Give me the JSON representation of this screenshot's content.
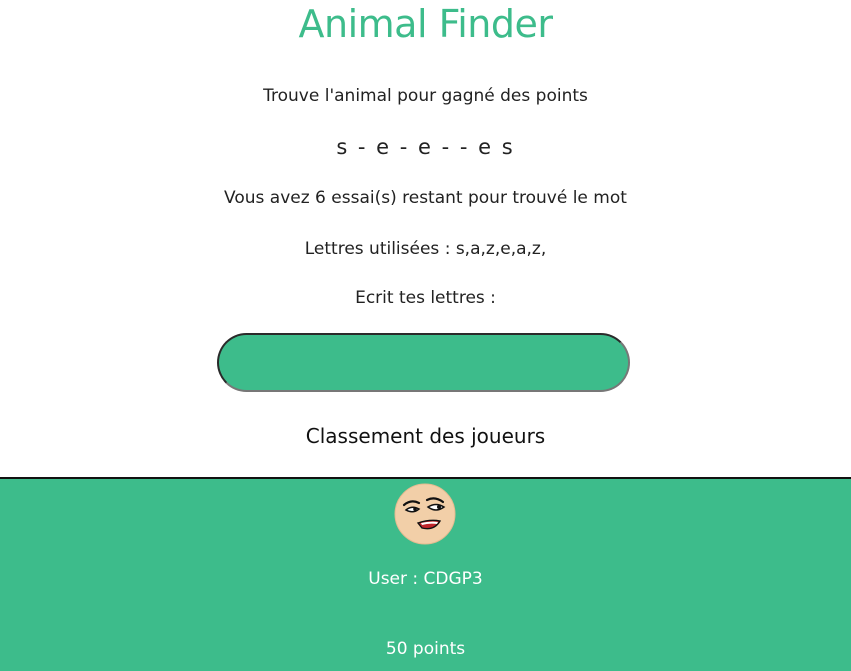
{
  "app": {
    "title": "Animal Finder"
  },
  "game": {
    "instruction": "Trouve l'animal pour gagné des points",
    "hidden_word": "s - e - e - - e s",
    "attempts_text": "Vous avez 6 essai(s) restant pour trouvé le mot",
    "used_letters_text": "Lettres utilisées : s,a,z,e,a,z,",
    "prompt_label": "Ecrit tes lettres :",
    "input_value": ""
  },
  "ranking": {
    "title": "Classement des joueurs",
    "players": [
      {
        "user_text": "User : CDGP3",
        "points_text": "50 points",
        "avatar_icon": "laughing-face-icon"
      }
    ]
  },
  "colors": {
    "accent": "#3dbc8b",
    "text": "#222222",
    "footer_text": "#ffffff"
  }
}
